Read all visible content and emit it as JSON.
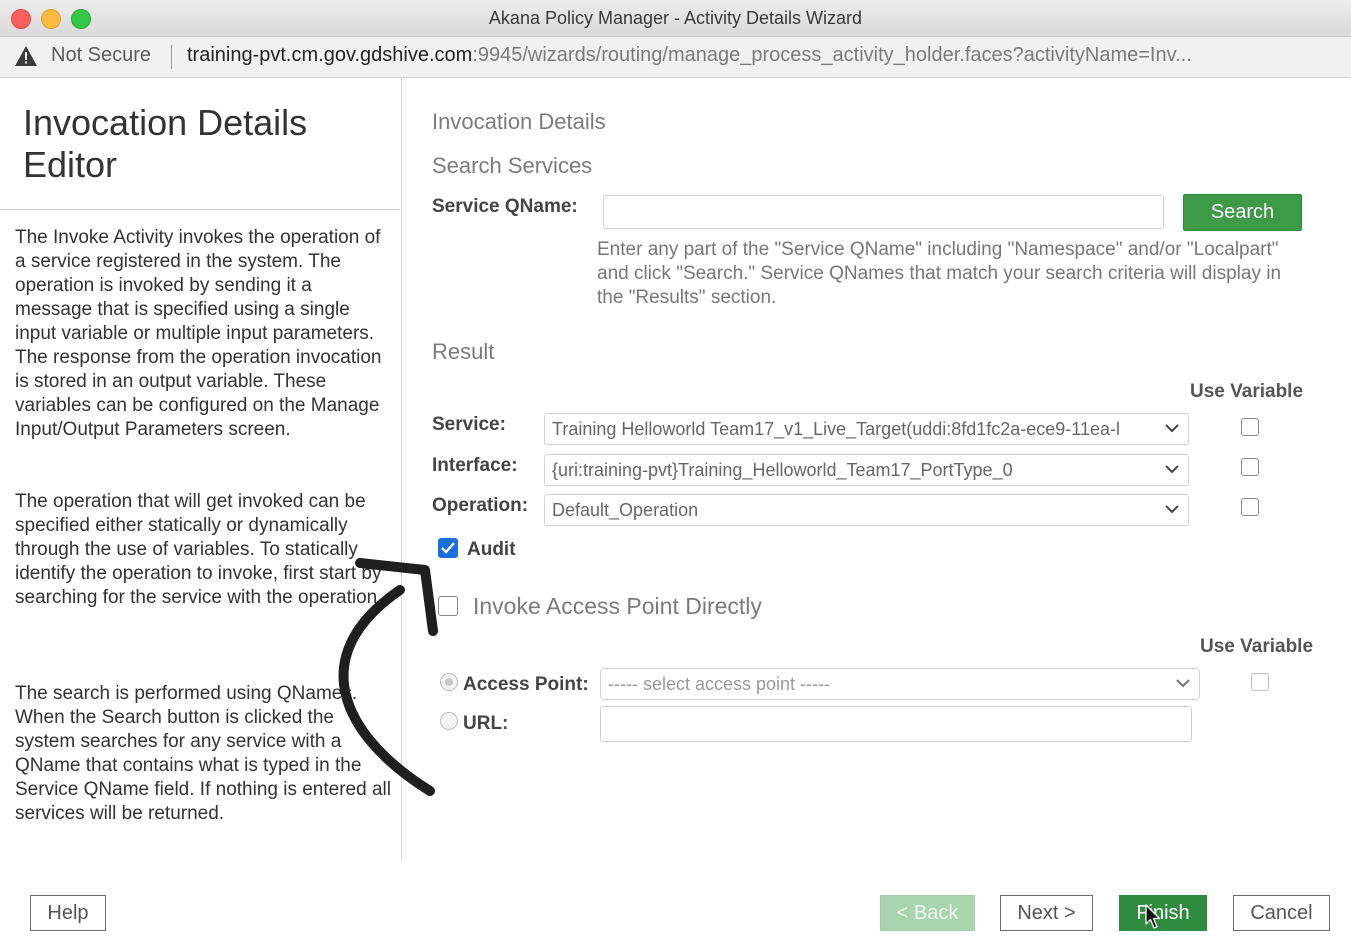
{
  "window": {
    "title": "Akana Policy Manager - Activity Details Wizard"
  },
  "address_bar": {
    "security_label": "Not Secure",
    "url_host": "training-pvt.cm.gov.gdshive.com",
    "url_rest": ":9945/wizards/routing/manage_process_activity_holder.faces?activityName=Inv..."
  },
  "sidebar": {
    "title_line1": "Invocation Details",
    "title_line2": "Editor",
    "paragraphs": [
      "The Invoke Activity invokes the operation of a service registered in the system. The operation is invoked by sending it a message that is specified using a single input variable or multiple input parameters. The response from the operation invocation is stored in an output variable. These variables can be configured on the Manage Input/Output Parameters screen.",
      "The operation that will get invoked can be specified either statically or dynamically through the use of variables. To statically identify the operation to invoke, first start by searching for the service with the operation.",
      "The search is performed using QNames. When the Search button is clicked the system searches for any service with a QName that contains what is typed in the Service QName field. If nothing is entered all services will be returned."
    ]
  },
  "main": {
    "section_invocation": "Invocation Details",
    "section_search": "Search Services",
    "service_qname_label": "Service QName:",
    "service_qname_value": "",
    "search_button": "Search",
    "search_help": "Enter any part of the \"Service QName\" including \"Namespace\" and/or \"Localpart\" and click \"Search.\" Service QNames that match your search criteria will display in the \"Results\" section.",
    "section_result": "Result",
    "use_variable_label": "Use Variable",
    "service_label": "Service:",
    "service_value": "Training Helloworld Team17_v1_Live_Target(uddi:8fd1fc2a-ece9-11ea-l",
    "service_use_variable": false,
    "interface_label": "Interface:",
    "interface_value": "{uri:training-pvt}Training_Helloworld_Team17_PortType_0",
    "interface_use_variable": false,
    "operation_label": "Operation:",
    "operation_value": "Default_Operation",
    "operation_use_variable": false,
    "audit_label": "Audit",
    "audit_checked": true,
    "invoke_direct_label": "Invoke Access Point Directly",
    "invoke_direct_checked": false,
    "use_variable_label_2": "Use Variable",
    "access_point_label": "Access Point:",
    "access_point_value": "----- select access point -----",
    "url_label": "URL:",
    "url_value": ""
  },
  "footer": {
    "help": "Help",
    "back": "< Back",
    "next": "Next >",
    "finish": "Finish",
    "cancel": "Cancel"
  },
  "colors": {
    "primary_green": "#3d9b47",
    "finish_green": "#2e8b3f",
    "checkbox_blue": "#1a6fe0"
  },
  "icons": [
    "warning-icon",
    "chevron-down-icon",
    "arrow-annotation-icon",
    "mouse-cursor-icon"
  ]
}
